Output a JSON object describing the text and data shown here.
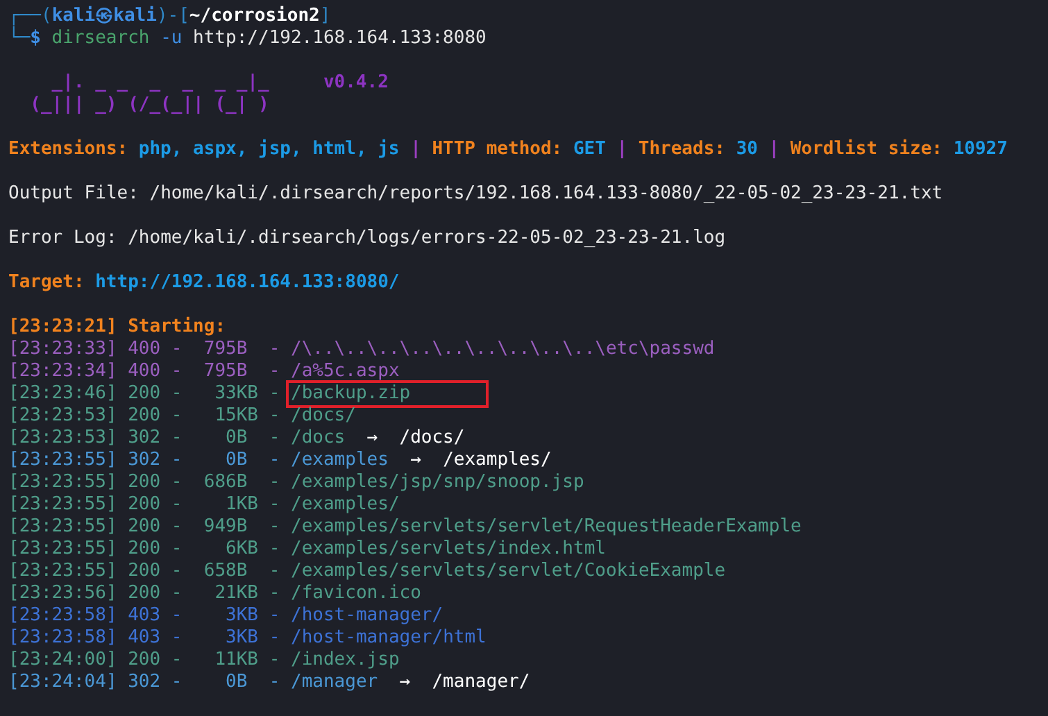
{
  "prompt": {
    "open": "┌──(",
    "user": "kali",
    "symbol": "㉿",
    "host": "kali",
    "mid": ")-[",
    "path": "~/corrosion2",
    "close": "]",
    "corner": "└─",
    "dollar": "$",
    "command": "dirsearch",
    "option": "-u",
    "argument": "http://192.168.164.133:8080"
  },
  "banner": {
    "lines": [
      "  _|. _ _  _  _  _ _|_",
      "(_||| _) (/_(_|| (_| )"
    ],
    "version": "v0.4.2"
  },
  "config": [
    {
      "label": "Extensions:",
      "value": "php, aspx, jsp, html, js"
    },
    {
      "label": "HTTP method:",
      "value": "GET"
    },
    {
      "label": "Threads:",
      "value": "30"
    },
    {
      "label": "Wordlist size:",
      "value": "10927"
    }
  ],
  "separator": "|",
  "output_file": "Output File: /home/kali/.dirsearch/reports/192.168.164.133-8080/_22-05-02_23-23-21.txt",
  "error_log": "Error Log: /home/kali/.dirsearch/logs/errors-22-05-02_23-23-21.log",
  "target": {
    "label": "Target:",
    "value": "http://192.168.164.133:8080/"
  },
  "starting": "[23:23:21] Starting:",
  "results": [
    {
      "entry": "[23:23:33] 400 -  795B  - ",
      "path": "/\\..\\..\\..\\..\\..\\..\\..\\..\\..\\etc\\passwd",
      "color": "#9b5fc0",
      "highlighted": false
    },
    {
      "entry": "[23:23:34] 400 -  795B  - ",
      "path": "/a%5c.aspx",
      "color": "#9b5fc0",
      "highlighted": false
    },
    {
      "entry": "[23:23:46] 200 -   33KB - ",
      "path": "/backup.zip",
      "color": "#4f9e8a",
      "highlighted": true
    },
    {
      "entry": "[23:23:53] 200 -   15KB - ",
      "path": "/docs/",
      "color": "#4f9e8a",
      "highlighted": false
    },
    {
      "entry": "[23:23:53] 302 -    0B  - ",
      "path": "/docs",
      "arrow": "→",
      "redirect": "/docs/",
      "color": "#4f9e8a",
      "highlighted": false
    },
    {
      "entry": "[23:23:55] 302 -    0B  - ",
      "path": "/examples",
      "arrow": "→",
      "redirect": "/examples/",
      "color": "#4b98d6",
      "highlighted": false
    },
    {
      "entry": "[23:23:55] 200 -  686B  - ",
      "path": "/examples/jsp/snp/snoop.jsp",
      "color": "#4f9e8a",
      "highlighted": false
    },
    {
      "entry": "[23:23:55] 200 -    1KB - ",
      "path": "/examples/",
      "color": "#4f9e8a",
      "highlighted": false
    },
    {
      "entry": "[23:23:55] 200 -  949B  - ",
      "path": "/examples/servlets/servlet/RequestHeaderExample",
      "color": "#4f9e8a",
      "highlighted": false
    },
    {
      "entry": "[23:23:55] 200 -    6KB - ",
      "path": "/examples/servlets/index.html",
      "color": "#4f9e8a",
      "highlighted": false
    },
    {
      "entry": "[23:23:55] 200 -  658B  - ",
      "path": "/examples/servlets/servlet/CookieExample",
      "color": "#4f9e8a",
      "highlighted": false
    },
    {
      "entry": "[23:23:56] 200 -   21KB - ",
      "path": "/favicon.ico",
      "color": "#4f9e8a",
      "highlighted": false
    },
    {
      "entry": "[23:23:58] 403 -    3KB - ",
      "path": "/host-manager/",
      "color": "#3d72d6",
      "highlighted": false
    },
    {
      "entry": "[23:23:58] 403 -    3KB - ",
      "path": "/host-manager/html",
      "color": "#3d72d6",
      "highlighted": false
    },
    {
      "entry": "[23:24:00] 200 -   11KB - ",
      "path": "/index.jsp",
      "color": "#4f9e8a",
      "highlighted": false
    },
    {
      "entry": "[23:24:04] 302 -    0B  - ",
      "path": "/manager",
      "arrow": "→",
      "redirect": "/manager/",
      "color": "#4b98d6",
      "highlighted": false
    }
  ]
}
